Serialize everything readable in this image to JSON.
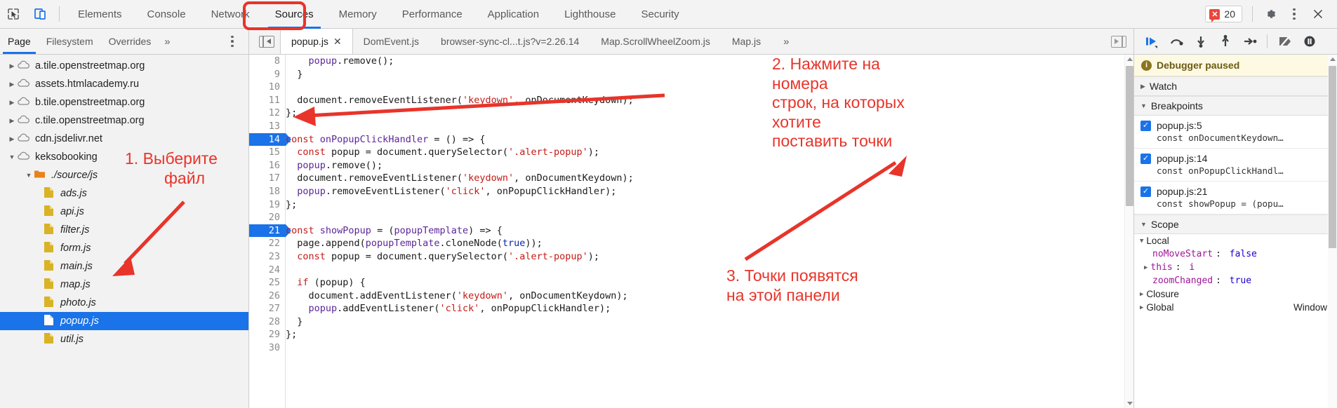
{
  "toolbar": {
    "inspect_icon": "inspect-cursor-icon",
    "device_icon": "device-toolbar-icon",
    "panels": [
      {
        "label": "Elements",
        "active": false
      },
      {
        "label": "Console",
        "active": false
      },
      {
        "label": "Network",
        "active": false
      },
      {
        "label": "Sources",
        "active": true
      },
      {
        "label": "Memory",
        "active": false
      },
      {
        "label": "Performance",
        "active": false
      },
      {
        "label": "Application",
        "active": false
      },
      {
        "label": "Lighthouse",
        "active": false
      },
      {
        "label": "Security",
        "active": false
      }
    ],
    "error_count": "20",
    "gear_icon": "gear-icon",
    "kebab_icon": "more-options-icon",
    "close_icon": "close-icon"
  },
  "navigator": {
    "tabs": [
      {
        "label": "Page",
        "active": true
      },
      {
        "label": "Filesystem",
        "active": false
      },
      {
        "label": "Overrides",
        "active": false
      }
    ],
    "more_label": "»",
    "kebab_icon": "more-options-icon",
    "tree": [
      {
        "label": "a.tile.openstreetmap.org",
        "type": "domain",
        "expanded": false,
        "indent": 0
      },
      {
        "label": "assets.htmlacademy.ru",
        "type": "domain",
        "expanded": false,
        "indent": 0
      },
      {
        "label": "b.tile.openstreetmap.org",
        "type": "domain",
        "expanded": false,
        "indent": 0
      },
      {
        "label": "c.tile.openstreetmap.org",
        "type": "domain",
        "expanded": false,
        "indent": 0
      },
      {
        "label": "cdn.jsdelivr.net",
        "type": "domain",
        "expanded": false,
        "indent": 0
      },
      {
        "label": "keksobooking",
        "type": "domain",
        "expanded": true,
        "indent": 0
      },
      {
        "label": "./source/js",
        "type": "folder",
        "expanded": true,
        "indent": 1
      },
      {
        "label": "ads.js",
        "type": "file",
        "indent": 2
      },
      {
        "label": "api.js",
        "type": "file",
        "indent": 2
      },
      {
        "label": "filter.js",
        "type": "file",
        "indent": 2
      },
      {
        "label": "form.js",
        "type": "file",
        "indent": 2
      },
      {
        "label": "main.js",
        "type": "file",
        "indent": 2
      },
      {
        "label": "map.js",
        "type": "file",
        "indent": 2
      },
      {
        "label": "photo.js",
        "type": "file",
        "indent": 2
      },
      {
        "label": "popup.js",
        "type": "file",
        "indent": 2,
        "selected": true
      },
      {
        "label": "util.js",
        "type": "file",
        "indent": 2
      }
    ]
  },
  "editor": {
    "sidebar_toggle_icon": "navigator-toggle-icon",
    "tabs": [
      {
        "label": "popup.js",
        "active": true,
        "closable": true
      },
      {
        "label": "DomEvent.js",
        "active": false
      },
      {
        "label": "browser-sync-cl...t.js?v=2.26.14",
        "active": false
      },
      {
        "label": "Map.ScrollWheelZoom.js",
        "active": false
      },
      {
        "label": "Map.js",
        "active": false
      }
    ],
    "more_tabs_label": "»",
    "drawer_toggle_icon": "drawer-toggle-icon",
    "close_tab_glyph": "✕",
    "lines": [
      {
        "n": 8,
        "bp": false,
        "tokens": [
          {
            "t": "    ",
            "c": "plain"
          },
          {
            "t": "popup",
            "c": "var"
          },
          {
            "t": ".remove();",
            "c": "plain"
          }
        ]
      },
      {
        "n": 9,
        "bp": false,
        "tokens": [
          {
            "t": "  }",
            "c": "plain"
          }
        ]
      },
      {
        "n": 10,
        "bp": false,
        "tokens": [
          {
            "t": "",
            "c": "plain"
          }
        ]
      },
      {
        "n": 11,
        "bp": false,
        "tokens": [
          {
            "t": "  document.removeEventListener(",
            "c": "plain"
          },
          {
            "t": "'keydown'",
            "c": "str"
          },
          {
            "t": ", onDocumentKeydown);",
            "c": "plain"
          }
        ]
      },
      {
        "n": 12,
        "bp": false,
        "tokens": [
          {
            "t": "};",
            "c": "plain"
          }
        ]
      },
      {
        "n": 13,
        "bp": false,
        "tokens": [
          {
            "t": "",
            "c": "plain"
          }
        ]
      },
      {
        "n": 14,
        "bp": true,
        "tokens": [
          {
            "t": "const",
            "c": "kw"
          },
          {
            "t": " ",
            "c": "plain"
          },
          {
            "t": "onPopupClickHandler",
            "c": "var"
          },
          {
            "t": " = () => {",
            "c": "plain"
          }
        ]
      },
      {
        "n": 15,
        "bp": false,
        "tokens": [
          {
            "t": "  ",
            "c": "plain"
          },
          {
            "t": "const",
            "c": "kw"
          },
          {
            "t": " popup = document.querySelector(",
            "c": "plain"
          },
          {
            "t": "'.alert-popup'",
            "c": "str"
          },
          {
            "t": ");",
            "c": "plain"
          }
        ]
      },
      {
        "n": 16,
        "bp": false,
        "tokens": [
          {
            "t": "  ",
            "c": "plain"
          },
          {
            "t": "popup",
            "c": "var"
          },
          {
            "t": ".remove();",
            "c": "plain"
          }
        ]
      },
      {
        "n": 17,
        "bp": false,
        "tokens": [
          {
            "t": "  document.removeEventListener(",
            "c": "plain"
          },
          {
            "t": "'keydown'",
            "c": "str"
          },
          {
            "t": ", onDocumentKeydown);",
            "c": "plain"
          }
        ]
      },
      {
        "n": 18,
        "bp": false,
        "tokens": [
          {
            "t": "  ",
            "c": "plain"
          },
          {
            "t": "popup",
            "c": "var"
          },
          {
            "t": ".removeEventListener(",
            "c": "plain"
          },
          {
            "t": "'click'",
            "c": "str"
          },
          {
            "t": ", onPopupClickHandler);",
            "c": "plain"
          }
        ]
      },
      {
        "n": 19,
        "bp": false,
        "tokens": [
          {
            "t": "};",
            "c": "plain"
          }
        ]
      },
      {
        "n": 20,
        "bp": false,
        "tokens": [
          {
            "t": "",
            "c": "plain"
          }
        ]
      },
      {
        "n": 21,
        "bp": true,
        "tokens": [
          {
            "t": "const",
            "c": "kw"
          },
          {
            "t": " ",
            "c": "plain"
          },
          {
            "t": "showPopup",
            "c": "var"
          },
          {
            "t": " = (",
            "c": "plain"
          },
          {
            "t": "popupTemplate",
            "c": "var"
          },
          {
            "t": ") => {",
            "c": "plain"
          }
        ]
      },
      {
        "n": 22,
        "bp": false,
        "tokens": [
          {
            "t": "  page.append(",
            "c": "plain"
          },
          {
            "t": "popupTemplate",
            "c": "var"
          },
          {
            "t": ".cloneNode(",
            "c": "plain"
          },
          {
            "t": "true",
            "c": "bool"
          },
          {
            "t": "));",
            "c": "plain"
          }
        ]
      },
      {
        "n": 23,
        "bp": false,
        "tokens": [
          {
            "t": "  ",
            "c": "plain"
          },
          {
            "t": "const",
            "c": "kw"
          },
          {
            "t": " popup = document.querySelector(",
            "c": "plain"
          },
          {
            "t": "'.alert-popup'",
            "c": "str"
          },
          {
            "t": ");",
            "c": "plain"
          }
        ]
      },
      {
        "n": 24,
        "bp": false,
        "tokens": [
          {
            "t": "",
            "c": "plain"
          }
        ]
      },
      {
        "n": 25,
        "bp": false,
        "tokens": [
          {
            "t": "  ",
            "c": "plain"
          },
          {
            "t": "if",
            "c": "kw"
          },
          {
            "t": " (popup) {",
            "c": "plain"
          }
        ]
      },
      {
        "n": 26,
        "bp": false,
        "tokens": [
          {
            "t": "    document.addEventListener(",
            "c": "plain"
          },
          {
            "t": "'keydown'",
            "c": "str"
          },
          {
            "t": ", onDocumentKeydown);",
            "c": "plain"
          }
        ]
      },
      {
        "n": 27,
        "bp": false,
        "tokens": [
          {
            "t": "    ",
            "c": "plain"
          },
          {
            "t": "popup",
            "c": "var"
          },
          {
            "t": ".addEventListener(",
            "c": "plain"
          },
          {
            "t": "'click'",
            "c": "str"
          },
          {
            "t": ", onPopupClickHandler);",
            "c": "plain"
          }
        ]
      },
      {
        "n": 28,
        "bp": false,
        "tokens": [
          {
            "t": "  }",
            "c": "plain"
          }
        ]
      },
      {
        "n": 29,
        "bp": false,
        "tokens": [
          {
            "t": "};",
            "c": "plain"
          }
        ]
      },
      {
        "n": 30,
        "bp": false,
        "tokens": [
          {
            "t": "",
            "c": "plain"
          }
        ]
      }
    ]
  },
  "debug_controls": [
    {
      "name": "resume-script-execution-icon"
    },
    {
      "name": "step-over-icon"
    },
    {
      "name": "step-into-icon"
    },
    {
      "name": "step-out-icon"
    },
    {
      "name": "step-icon"
    },
    {
      "name": "deactivate-breakpoints-icon"
    },
    {
      "name": "pause-on-exceptions-icon"
    }
  ],
  "debug_sidebar": {
    "paused_text": "Debugger paused",
    "info_glyph": "i",
    "sections": {
      "watch": {
        "label": "Watch",
        "expanded": false
      },
      "breakpoints": {
        "label": "Breakpoints",
        "expanded": true
      },
      "scope": {
        "label": "Scope",
        "expanded": true
      }
    },
    "breakpoints": [
      {
        "location": "popup.js:5",
        "snippet": "const onDocumentKeydown…",
        "checked": true
      },
      {
        "location": "popup.js:14",
        "snippet": "const onPopupClickHandl…",
        "checked": true
      },
      {
        "location": "popup.js:21",
        "snippet": "const showPopup = (popu…",
        "checked": true
      }
    ],
    "scope": [
      {
        "kind": "group",
        "label": "Local",
        "expanded": true,
        "indent": 0
      },
      {
        "kind": "prop",
        "name": "noMoveStart",
        "value": "false",
        "indent": 1
      },
      {
        "kind": "obj",
        "label": "this",
        "value": "i",
        "indent": 1,
        "expandable": true
      },
      {
        "kind": "prop",
        "name": "zoomChanged",
        "value": "true",
        "indent": 1
      },
      {
        "kind": "group",
        "label": "Closure",
        "expanded": false,
        "indent": 0
      },
      {
        "kind": "group",
        "label": "Global",
        "expanded": false,
        "indent": 0,
        "value": "Window"
      }
    ]
  },
  "annotations": [
    {
      "id": "anno-1",
      "text_lines": [
        "1. Выберите",
        "файл"
      ]
    },
    {
      "id": "anno-2",
      "text_lines": [
        "2. Нажмите на номера",
        "строк, на которых хотите",
        "поставить точки"
      ]
    },
    {
      "id": "anno-3",
      "text_lines": [
        "3. Точки появятся",
        "на этой панели"
      ]
    }
  ],
  "colors": {
    "accent": "#1a73e8",
    "annotation_red": "#e8342a",
    "error_red": "#e8483b",
    "paused_bg": "#fdf9e2"
  }
}
